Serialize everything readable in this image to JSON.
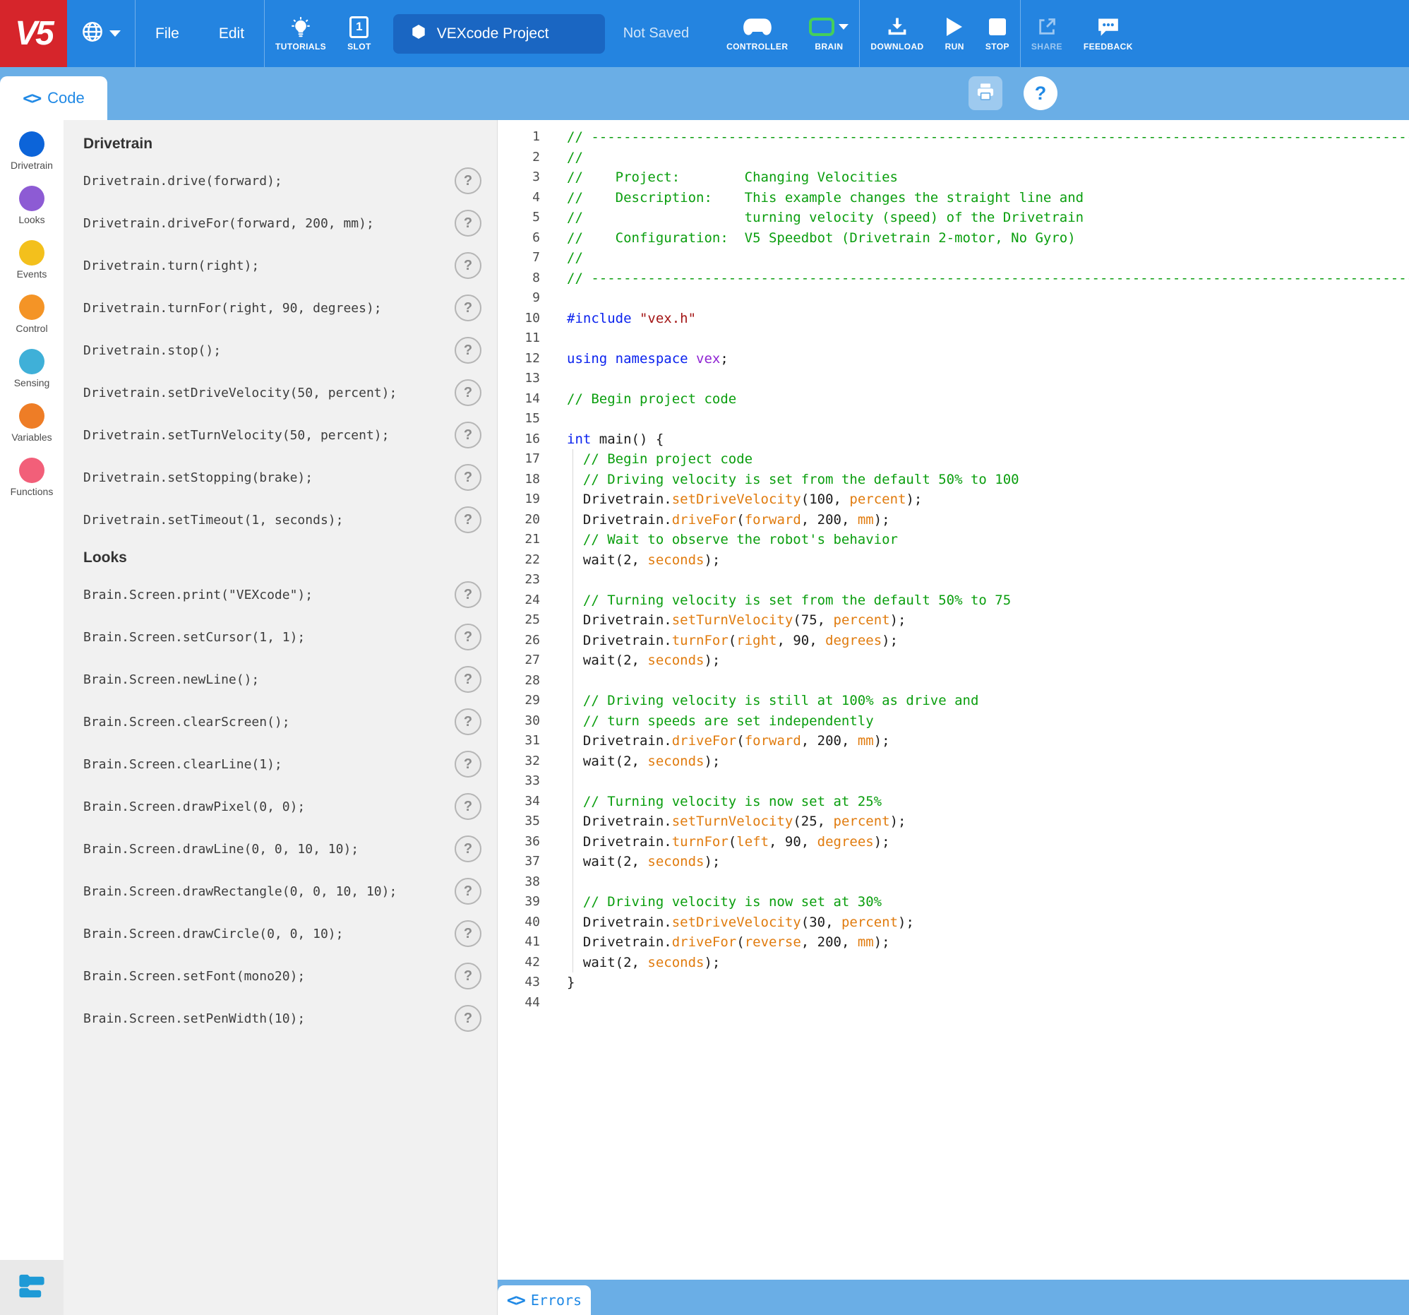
{
  "topbar": {
    "logo": "V5",
    "menus": [
      {
        "label": "File"
      },
      {
        "label": "Edit"
      }
    ],
    "tutorials_label": "TUTORIALS",
    "slot_label": "SLOT",
    "slot_number": "1",
    "project_name": "VEXcode Project",
    "save_status": "Not Saved",
    "controller_label": "CONTROLLER",
    "brain_label": "BRAIN",
    "download_label": "DOWNLOAD",
    "run_label": "RUN",
    "stop_label": "STOP",
    "share_label": "SHARE",
    "feedback_label": "FEEDBACK",
    "colors": {
      "bar": "#2484e0",
      "logo_bg": "#d6252b",
      "project_box": "#1a66c2",
      "brain_green": "#45cf5a"
    }
  },
  "tabbar": {
    "code_label": "Code",
    "help_label": "?"
  },
  "sidebar": {
    "categories": [
      {
        "label": "Drivetrain",
        "color": "#0c64d9"
      },
      {
        "label": "Looks",
        "color": "#8d5bd4"
      },
      {
        "label": "Events",
        "color": "#f3c01c"
      },
      {
        "label": "Control",
        "color": "#f49426"
      },
      {
        "label": "Sensing",
        "color": "#3fb0d8"
      },
      {
        "label": "Variables",
        "color": "#ee7d26"
      },
      {
        "label": "Functions",
        "color": "#f25f79"
      }
    ]
  },
  "palette": {
    "sections": [
      {
        "title": "Drivetrain",
        "commands": [
          "Drivetrain.drive(forward);",
          "Drivetrain.driveFor(forward, 200, mm);",
          "Drivetrain.turn(right);",
          "Drivetrain.turnFor(right, 90, degrees);",
          "Drivetrain.stop();",
          "Drivetrain.setDriveVelocity(50, percent);",
          "Drivetrain.setTurnVelocity(50, percent);",
          "Drivetrain.setStopping(brake);",
          "Drivetrain.setTimeout(1, seconds);"
        ]
      },
      {
        "title": "Looks",
        "commands": [
          "Brain.Screen.print(\"VEXcode\");",
          "Brain.Screen.setCursor(1, 1);",
          "Brain.Screen.newLine();",
          "Brain.Screen.clearScreen();",
          "Brain.Screen.clearLine(1);",
          "Brain.Screen.drawPixel(0, 0);",
          "Brain.Screen.drawLine(0, 0, 10, 10);",
          "Brain.Screen.drawRectangle(0, 0, 10, 10);",
          "Brain.Screen.drawCircle(0, 0, 10);",
          "Brain.Screen.setFont(mono20);",
          "Brain.Screen.setPenWidth(10);"
        ]
      }
    ],
    "help_glyph": "?"
  },
  "editor": {
    "syntax_colors": {
      "comment": "#0a9e0e",
      "keyword": "#0a22ee",
      "string": "#a31515",
      "namespace": "#8f24d3",
      "call": "#e07b0e"
    },
    "lines": [
      {
        "n": "1",
        "seg": [
          [
            "cm",
            "// --------------------------------------------------------------------------------------------------------------"
          ]
        ]
      },
      {
        "n": "2",
        "seg": [
          [
            "cm",
            "//"
          ]
        ]
      },
      {
        "n": "3",
        "seg": [
          [
            "cm",
            "//    Project:        Changing Velocities"
          ]
        ]
      },
      {
        "n": "4",
        "seg": [
          [
            "cm",
            "//    Description:    This example changes the straight line and"
          ]
        ]
      },
      {
        "n": "5",
        "seg": [
          [
            "cm",
            "//                    turning velocity (speed) of the Drivetrain"
          ]
        ]
      },
      {
        "n": "6",
        "seg": [
          [
            "cm",
            "//    Configuration:  V5 Speedbot (Drivetrain 2-motor, No Gyro)"
          ]
        ]
      },
      {
        "n": "7",
        "seg": [
          [
            "cm",
            "//"
          ]
        ]
      },
      {
        "n": "8",
        "seg": [
          [
            "cm",
            "// --------------------------------------------------------------------------------------------------------------"
          ]
        ]
      },
      {
        "n": "9",
        "seg": []
      },
      {
        "n": "10",
        "seg": [
          [
            "pp",
            "#include "
          ],
          [
            "str",
            "\"vex.h\""
          ]
        ]
      },
      {
        "n": "11",
        "seg": []
      },
      {
        "n": "12",
        "seg": [
          [
            "kw",
            "using namespace"
          ],
          [
            "pl",
            " "
          ],
          [
            "ns",
            "vex"
          ],
          [
            "pl",
            ";"
          ]
        ]
      },
      {
        "n": "13",
        "seg": []
      },
      {
        "n": "14",
        "seg": [
          [
            "cm",
            "// Begin project code"
          ]
        ]
      },
      {
        "n": "15",
        "seg": []
      },
      {
        "n": "16",
        "seg": [
          [
            "kw",
            "int"
          ],
          [
            "pl",
            " main() {"
          ]
        ]
      },
      {
        "n": "17",
        "seg": [
          [
            "cm",
            "  // Begin project code"
          ]
        ]
      },
      {
        "n": "18",
        "seg": [
          [
            "cm",
            "  // Driving velocity is set from the default 50% to 100"
          ]
        ]
      },
      {
        "n": "19",
        "seg": [
          [
            "pl",
            "  Drivetrain."
          ],
          [
            "or",
            "setDriveVelocity"
          ],
          [
            "pl",
            "(100, "
          ],
          [
            "or",
            "percent"
          ],
          [
            "pl",
            ");"
          ]
        ]
      },
      {
        "n": "20",
        "seg": [
          [
            "pl",
            "  Drivetrain."
          ],
          [
            "or",
            "driveFor"
          ],
          [
            "pl",
            "("
          ],
          [
            "or",
            "forward"
          ],
          [
            "pl",
            ", 200, "
          ],
          [
            "or",
            "mm"
          ],
          [
            "pl",
            ");"
          ]
        ]
      },
      {
        "n": "21",
        "seg": [
          [
            "cm",
            "  // Wait to observe the robot's behavior"
          ]
        ]
      },
      {
        "n": "22",
        "seg": [
          [
            "pl",
            "  wait(2, "
          ],
          [
            "or",
            "seconds"
          ],
          [
            "pl",
            ");"
          ]
        ]
      },
      {
        "n": "23",
        "seg": []
      },
      {
        "n": "24",
        "seg": [
          [
            "cm",
            "  // Turning velocity is set from the default 50% to 75"
          ]
        ]
      },
      {
        "n": "25",
        "seg": [
          [
            "pl",
            "  Drivetrain."
          ],
          [
            "or",
            "setTurnVelocity"
          ],
          [
            "pl",
            "(75, "
          ],
          [
            "or",
            "percent"
          ],
          [
            "pl",
            ");"
          ]
        ]
      },
      {
        "n": "26",
        "seg": [
          [
            "pl",
            "  Drivetrain."
          ],
          [
            "or",
            "turnFor"
          ],
          [
            "pl",
            "("
          ],
          [
            "or",
            "right"
          ],
          [
            "pl",
            ", 90, "
          ],
          [
            "or",
            "degrees"
          ],
          [
            "pl",
            ");"
          ]
        ]
      },
      {
        "n": "27",
        "seg": [
          [
            "pl",
            "  wait(2, "
          ],
          [
            "or",
            "seconds"
          ],
          [
            "pl",
            ");"
          ]
        ]
      },
      {
        "n": "28",
        "seg": []
      },
      {
        "n": "29",
        "seg": [
          [
            "cm",
            "  // Driving velocity is still at 100% as drive and"
          ]
        ]
      },
      {
        "n": "30",
        "seg": [
          [
            "cm",
            "  // turn speeds are set independently"
          ]
        ]
      },
      {
        "n": "31",
        "seg": [
          [
            "pl",
            "  Drivetrain."
          ],
          [
            "or",
            "driveFor"
          ],
          [
            "pl",
            "("
          ],
          [
            "or",
            "forward"
          ],
          [
            "pl",
            ", 200, "
          ],
          [
            "or",
            "mm"
          ],
          [
            "pl",
            ");"
          ]
        ]
      },
      {
        "n": "32",
        "seg": [
          [
            "pl",
            "  wait(2, "
          ],
          [
            "or",
            "seconds"
          ],
          [
            "pl",
            ");"
          ]
        ]
      },
      {
        "n": "33",
        "seg": []
      },
      {
        "n": "34",
        "seg": [
          [
            "cm",
            "  // Turning velocity is now set at 25%"
          ]
        ]
      },
      {
        "n": "35",
        "seg": [
          [
            "pl",
            "  Drivetrain."
          ],
          [
            "or",
            "setTurnVelocity"
          ],
          [
            "pl",
            "(25, "
          ],
          [
            "or",
            "percent"
          ],
          [
            "pl",
            ");"
          ]
        ]
      },
      {
        "n": "36",
        "seg": [
          [
            "pl",
            "  Drivetrain."
          ],
          [
            "or",
            "turnFor"
          ],
          [
            "pl",
            "("
          ],
          [
            "or",
            "left"
          ],
          [
            "pl",
            ", 90, "
          ],
          [
            "or",
            "degrees"
          ],
          [
            "pl",
            ");"
          ]
        ]
      },
      {
        "n": "37",
        "seg": [
          [
            "pl",
            "  wait(2, "
          ],
          [
            "or",
            "seconds"
          ],
          [
            "pl",
            ");"
          ]
        ]
      },
      {
        "n": "38",
        "seg": []
      },
      {
        "n": "39",
        "seg": [
          [
            "cm",
            "  // Driving velocity is now set at 30%"
          ]
        ]
      },
      {
        "n": "40",
        "seg": [
          [
            "pl",
            "  Drivetrain."
          ],
          [
            "or",
            "setDriveVelocity"
          ],
          [
            "pl",
            "(30, "
          ],
          [
            "or",
            "percent"
          ],
          [
            "pl",
            ");"
          ]
        ]
      },
      {
        "n": "41",
        "seg": [
          [
            "pl",
            "  Drivetrain."
          ],
          [
            "or",
            "driveFor"
          ],
          [
            "pl",
            "("
          ],
          [
            "or",
            "reverse"
          ],
          [
            "pl",
            ", 200, "
          ],
          [
            "or",
            "mm"
          ],
          [
            "pl",
            ");"
          ]
        ]
      },
      {
        "n": "42",
        "seg": [
          [
            "pl",
            "  wait(2, "
          ],
          [
            "or",
            "seconds"
          ],
          [
            "pl",
            ");"
          ]
        ]
      },
      {
        "n": "43",
        "seg": [
          [
            "pl",
            "}"
          ]
        ]
      },
      {
        "n": "44",
        "seg": []
      }
    ]
  },
  "errors": {
    "label": "Errors"
  }
}
